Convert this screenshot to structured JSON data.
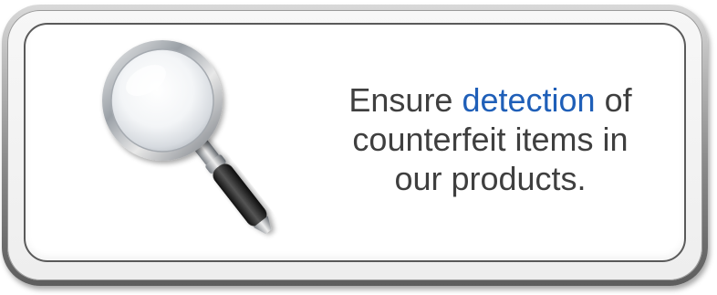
{
  "message": {
    "part1": "Ensure ",
    "highlight": "detection",
    "part2": " of counterfeit items in our products."
  },
  "icons": {
    "main": "magnifying-glass-icon"
  },
  "colors": {
    "text": "#3f3f3f",
    "highlight": "#1f5fb8",
    "frame": "#8c8c8c",
    "panel": "#ffffff"
  }
}
